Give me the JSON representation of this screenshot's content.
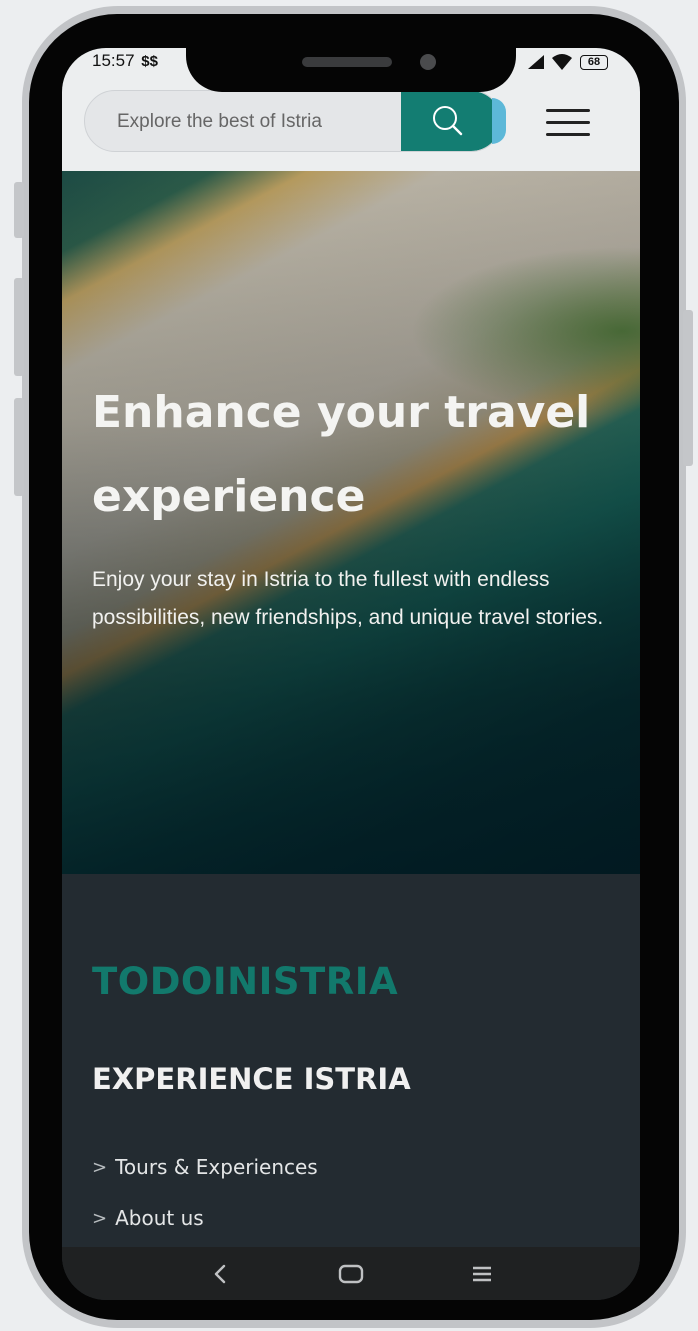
{
  "status_bar": {
    "time": "15:57",
    "battery": "68"
  },
  "header": {
    "search": {
      "placeholder": "Explore the best of Istria",
      "button_icon": "search-icon"
    },
    "menu_icon": "hamburger-menu-icon"
  },
  "hero": {
    "title": "Enhance your travel experience",
    "text": "Enjoy your stay in Istria to the fullest with endless possibilities, new friendships, and unique travel stories."
  },
  "footer": {
    "brand": "TODOINISTRIA",
    "section_title": "EXPERIENCE ISTRIA",
    "links": [
      {
        "label": "Tours & Experiences"
      },
      {
        "label": "About us"
      }
    ]
  },
  "navbar": {
    "icons": [
      "back-icon",
      "home-icon",
      "recents-icon"
    ]
  },
  "colors": {
    "accent": "#137d72",
    "footer_bg": "#232b31",
    "header_bg": "#eceeef"
  }
}
